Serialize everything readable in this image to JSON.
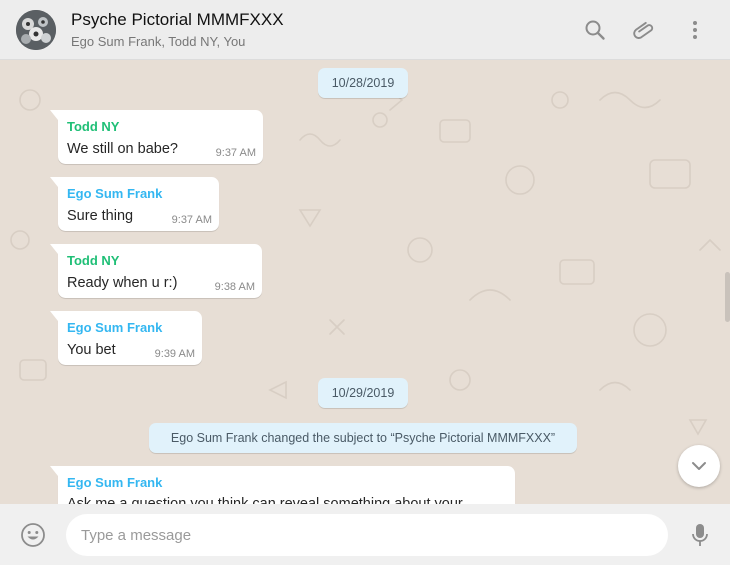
{
  "header": {
    "title": "Psyche Pictorial MMMFXXX",
    "participants": "Ego Sum Frank, Todd NY, You",
    "icons": [
      "search-icon",
      "attach-icon",
      "menu-icon"
    ]
  },
  "colors": {
    "sender_todd": "#1fbf76",
    "sender_frank": "#34b7f1",
    "chip_bg": "#e1f2fb",
    "bubble_bg": "#ffffff",
    "wallpaper": "#e7ded5"
  },
  "dates": [
    "10/28/2019",
    "10/29/2019"
  ],
  "messages": [
    {
      "sender": "Todd NY",
      "text": "We still on babe?",
      "time": "9:37 AM"
    },
    {
      "sender": "Ego Sum Frank",
      "text": "Sure thing",
      "time": "9:37 AM"
    },
    {
      "sender": "Todd NY",
      "text": "Ready when u r:)",
      "time": "9:38 AM"
    },
    {
      "sender": "Ego Sum Frank",
      "text": "You bet",
      "time": "9:39 AM"
    },
    {
      "sender": "Ego Sum Frank",
      "text": "Ask me a question you think can reveal something about your",
      "time": ""
    }
  ],
  "system_message": "Ego Sum Frank changed the subject to “Psyche Pictorial MMMFXXX”",
  "composer": {
    "placeholder": "Type a message"
  }
}
